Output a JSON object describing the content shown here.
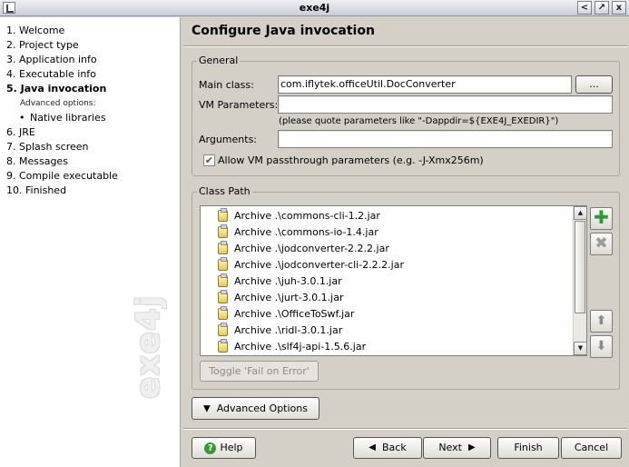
{
  "window": {
    "title": "exe4j",
    "buttons": [
      "<",
      "↗",
      "x"
    ]
  },
  "sidebar": {
    "steps": [
      {
        "label": "1. Welcome"
      },
      {
        "label": "2. Project type"
      },
      {
        "label": "3. Application info"
      },
      {
        "label": "4. Executable info"
      },
      {
        "label": "5. Java invocation"
      },
      {
        "label": "Advanced options:"
      },
      {
        "label": "Native libraries"
      },
      {
        "label": "6. JRE"
      },
      {
        "label": "7. Splash screen"
      },
      {
        "label": "8. Messages"
      },
      {
        "label": "9. Compile executable"
      },
      {
        "label": "10. Finished"
      }
    ],
    "watermark": "exe4j"
  },
  "main": {
    "title": "Configure Java invocation",
    "general": {
      "group_label": "General",
      "main_class_label": "Main class:",
      "main_class_value": "com.iflytek.officeUtil.DocConverter",
      "browse_label": "...",
      "vm_params_label": "VM Parameters:",
      "vm_params_value": "",
      "vm_params_hint": "(please quote parameters like \"-Dappdir=${EXE4J_EXEDIR}\")",
      "arguments_label": "Arguments:",
      "arguments_value": "",
      "allow_passthrough_label": "Allow VM passthrough parameters (e.g. -J-Xmx256m)",
      "allow_passthrough_checked": true
    },
    "classpath": {
      "group_label": "Class Path",
      "entries": [
        "Archive .\\commons-cli-1.2.jar",
        "Archive .\\commons-io-1.4.jar",
        "Archive .\\jodconverter-2.2.2.jar",
        "Archive .\\jodconverter-cli-2.2.2.jar",
        "Archive .\\juh-3.0.1.jar",
        "Archive .\\jurt-3.0.1.jar",
        "Archive .\\OfficeToSwf.jar",
        "Archive .\\ridl-3.0.1.jar",
        "Archive .\\slf4j-api-1.5.6.jar"
      ],
      "toggle_fail_label": "Toggle 'Fail on Error'"
    },
    "advanced_options_label": "Advanced Options"
  },
  "footer": {
    "help_label": "Help",
    "back_label": "Back",
    "next_label": "Next",
    "finish_label": "Finish",
    "cancel_label": "Cancel"
  }
}
